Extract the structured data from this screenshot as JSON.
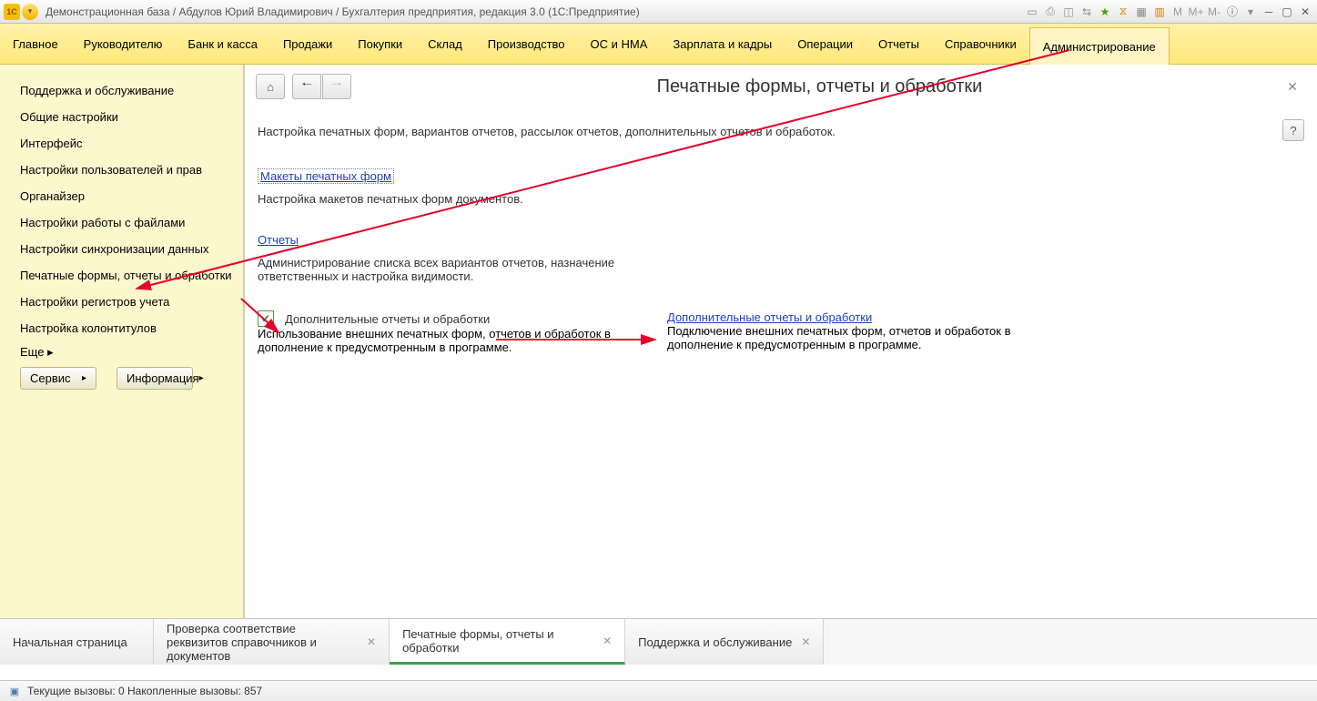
{
  "title": "Демонстрационная база / Абдулов Юрий Владимирович / Бухгалтерия предприятия, редакция 3.0  (1С:Предприятие)",
  "logo_text": "1C",
  "tb_icons": {
    "m1": "M",
    "m2": "M+",
    "m3": "M-"
  },
  "menu": {
    "items": [
      "Главное",
      "Руководителю",
      "Банк и касса",
      "Продажи",
      "Покупки",
      "Склад",
      "Производство",
      "ОС и НМА",
      "Зарплата и кадры",
      "Операции",
      "Отчеты",
      "Справочники",
      "Администрирование"
    ],
    "active_index": 12
  },
  "sidebar": {
    "items": [
      "Поддержка и обслуживание",
      "Общие настройки",
      "Интерфейс",
      "Настройки пользователей и прав",
      "Органайзер",
      "Настройки работы с файлами",
      "Настройки синхронизации данных",
      "Печатные формы, отчеты и обработки",
      "Настройки регистров учета",
      "Настройка колонтитулов"
    ],
    "more_label": "Еще ▸",
    "service_label": "Сервис",
    "info_label": "Информация"
  },
  "page": {
    "title": "Печатные формы, отчеты и обработки",
    "subtitle": "Настройка печатных форм, вариантов отчетов, рассылок отчетов, дополнительных отчетов и обработок.",
    "help": "?",
    "link1": "Макеты печатных форм",
    "desc1": "Настройка макетов печатных форм документов.",
    "link2": "Отчеты",
    "desc2": "Администрирование списка всех вариантов отчетов, назначение ответственных и настройка видимости.",
    "cb_label": "Дополнительные отчеты и обработки",
    "cb_checked": true,
    "desc3L": "Использование внешних печатных форм, отчетов и обработок в дополнение к предусмотренным в программе.",
    "link3R": "Дополнительные отчеты и обработки",
    "desc3R": "Подключение внешних печатных форм, отчетов и обработок в дополнение к предусмотренным в программе."
  },
  "tabs": [
    {
      "label": "Начальная страница",
      "closable": false,
      "active": false
    },
    {
      "label": "Проверка соответствие реквизитов справочников и документов",
      "closable": true,
      "active": false
    },
    {
      "label": "Печатные формы, отчеты и обработки",
      "closable": true,
      "active": true
    },
    {
      "label": "Поддержка и обслуживание",
      "closable": true,
      "active": false
    }
  ],
  "status": "Текущие вызовы: 0  Накопленные вызовы: 857"
}
